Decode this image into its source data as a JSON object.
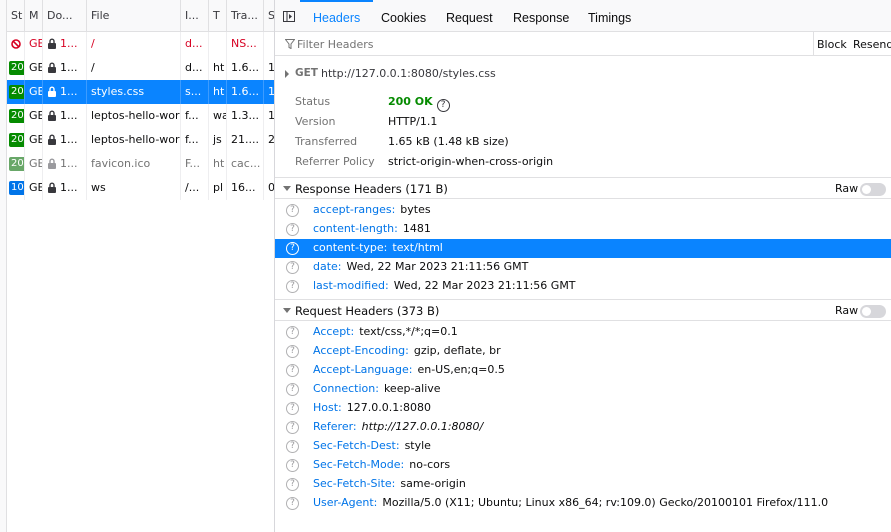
{
  "request_list": {
    "columns": [
      "St",
      "M",
      "Do...",
      "File",
      "I...",
      "T",
      "Tra...",
      "S"
    ],
    "rows": [
      {
        "status": "",
        "method": "GE",
        "domain": "1...",
        "file": "/",
        "initiator": "d...",
        "type": "",
        "transferred": "NS...",
        "size": "",
        "kind": "error"
      },
      {
        "status": "20",
        "method": "GE",
        "domain": "1...",
        "file": "/",
        "initiator": "d...",
        "type": "ht",
        "transferred": "1.6...",
        "size": "1",
        "kind": "ok"
      },
      {
        "status": "20",
        "method": "GE",
        "domain": "1...",
        "file": "styles.css",
        "initiator": "s...",
        "type": "ht",
        "transferred": "1.6...",
        "size": "1",
        "kind": "selected"
      },
      {
        "status": "20",
        "method": "GE",
        "domain": "1...",
        "file": "leptos-hello-world",
        "initiator": "f...",
        "type": "wa",
        "transferred": "1.3...",
        "size": "1",
        "kind": "ok"
      },
      {
        "status": "20",
        "method": "GE",
        "domain": "1...",
        "file": "leptos-hello-world",
        "initiator": "f...",
        "type": "js",
        "transferred": "21....",
        "size": "2",
        "kind": "ok"
      },
      {
        "status": "20",
        "method": "GE",
        "domain": "1...",
        "file": "favicon.ico",
        "initiator": "F...",
        "type": "ht",
        "transferred": "cac...",
        "size": "",
        "kind": "cached"
      },
      {
        "status": "10",
        "method": "GE",
        "domain": "1...",
        "file": "ws",
        "initiator": "/...",
        "type": "pl",
        "transferred": "16...",
        "size": "0",
        "kind": "ws"
      }
    ]
  },
  "tabs": [
    "Headers",
    "Cookies",
    "Request",
    "Response",
    "Timings"
  ],
  "filter": {
    "placeholder": "Filter Headers",
    "block_label": "Block",
    "resend_label": "Resend"
  },
  "summary": {
    "method": "GET",
    "url": "http://127.0.0.1:8080/styles.css",
    "rows": [
      {
        "label": "Status",
        "value": "200 OK"
      },
      {
        "label": "Version",
        "value": "HTTP/1.1"
      },
      {
        "label": "Transferred",
        "value": "1.65 kB (1.48 kB size)"
      },
      {
        "label": "Referrer Policy",
        "value": "strict-origin-when-cross-origin"
      }
    ]
  },
  "response_headers": {
    "title": "Response Headers (171 B)",
    "raw_label": "Raw",
    "items": [
      {
        "name": "accept-ranges:",
        "value": "bytes"
      },
      {
        "name": "content-length:",
        "value": "1481"
      },
      {
        "name": "content-type:",
        "value": "text/html"
      },
      {
        "name": "date:",
        "value": "Wed, 22 Mar 2023 21:11:56 GMT"
      },
      {
        "name": "last-modified:",
        "value": "Wed, 22 Mar 2023 21:11:56 GMT"
      }
    ]
  },
  "request_headers": {
    "title": "Request Headers (373 B)",
    "raw_label": "Raw",
    "items": [
      {
        "name": "Accept:",
        "value": "text/css,*/*;q=0.1"
      },
      {
        "name": "Accept-Encoding:",
        "value": "gzip, deflate, br"
      },
      {
        "name": "Accept-Language:",
        "value": "en-US,en;q=0.5"
      },
      {
        "name": "Connection:",
        "value": "keep-alive"
      },
      {
        "name": "Host:",
        "value": "127.0.0.1:8080"
      },
      {
        "name": "Referer:",
        "value": "http://127.0.0.1:8080/"
      },
      {
        "name": "Sec-Fetch-Dest:",
        "value": "style"
      },
      {
        "name": "Sec-Fetch-Mode:",
        "value": "no-cors"
      },
      {
        "name": "Sec-Fetch-Site:",
        "value": "same-origin"
      },
      {
        "name": "User-Agent:",
        "value": "Mozilla/5.0 (X11; Ubuntu; Linux x86_64; rv:109.0) Gecko/20100101 Firefox/111.0"
      }
    ]
  },
  "colors": {
    "accent": "#0a84ff",
    "status_ok": "#058b00",
    "error": "#d70022",
    "header_name": "#0074e8"
  },
  "icons": {
    "blocked": "blocked-icon",
    "lock": "lock-icon",
    "help": "question-icon",
    "filter": "filter-icon",
    "toggle": "sidebar-toggle-icon"
  }
}
